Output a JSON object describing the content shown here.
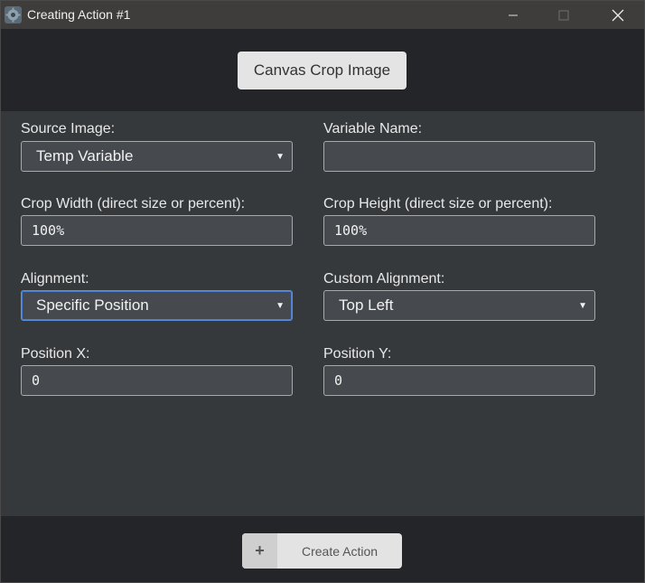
{
  "window": {
    "title": "Creating Action #1",
    "controls": {
      "minimize": "—",
      "maximize": "☐",
      "close": "✕"
    }
  },
  "header": {
    "button_label": "Canvas Crop Image"
  },
  "form": {
    "source_image": {
      "label": "Source Image:",
      "value": "Temp Variable"
    },
    "variable_name": {
      "label": "Variable Name:",
      "value": ""
    },
    "crop_width": {
      "label": "Crop Width (direct size or percent):",
      "value": "100%"
    },
    "crop_height": {
      "label": "Crop Height (direct size or percent):",
      "value": "100%"
    },
    "alignment": {
      "label": "Alignment:",
      "value": "Specific Position"
    },
    "custom_alignment": {
      "label": "Custom Alignment:",
      "value": "Top Left"
    },
    "position_x": {
      "label": "Position X:",
      "value": "0"
    },
    "position_y": {
      "label": "Position Y:",
      "value": "0"
    }
  },
  "footer": {
    "plus_icon": "+",
    "create_label": "Create Action"
  },
  "colors": {
    "titlebar": "#3e3d3b",
    "header_band": "#242528",
    "form_bg": "#36393c",
    "focus_border": "#5b8fde"
  }
}
